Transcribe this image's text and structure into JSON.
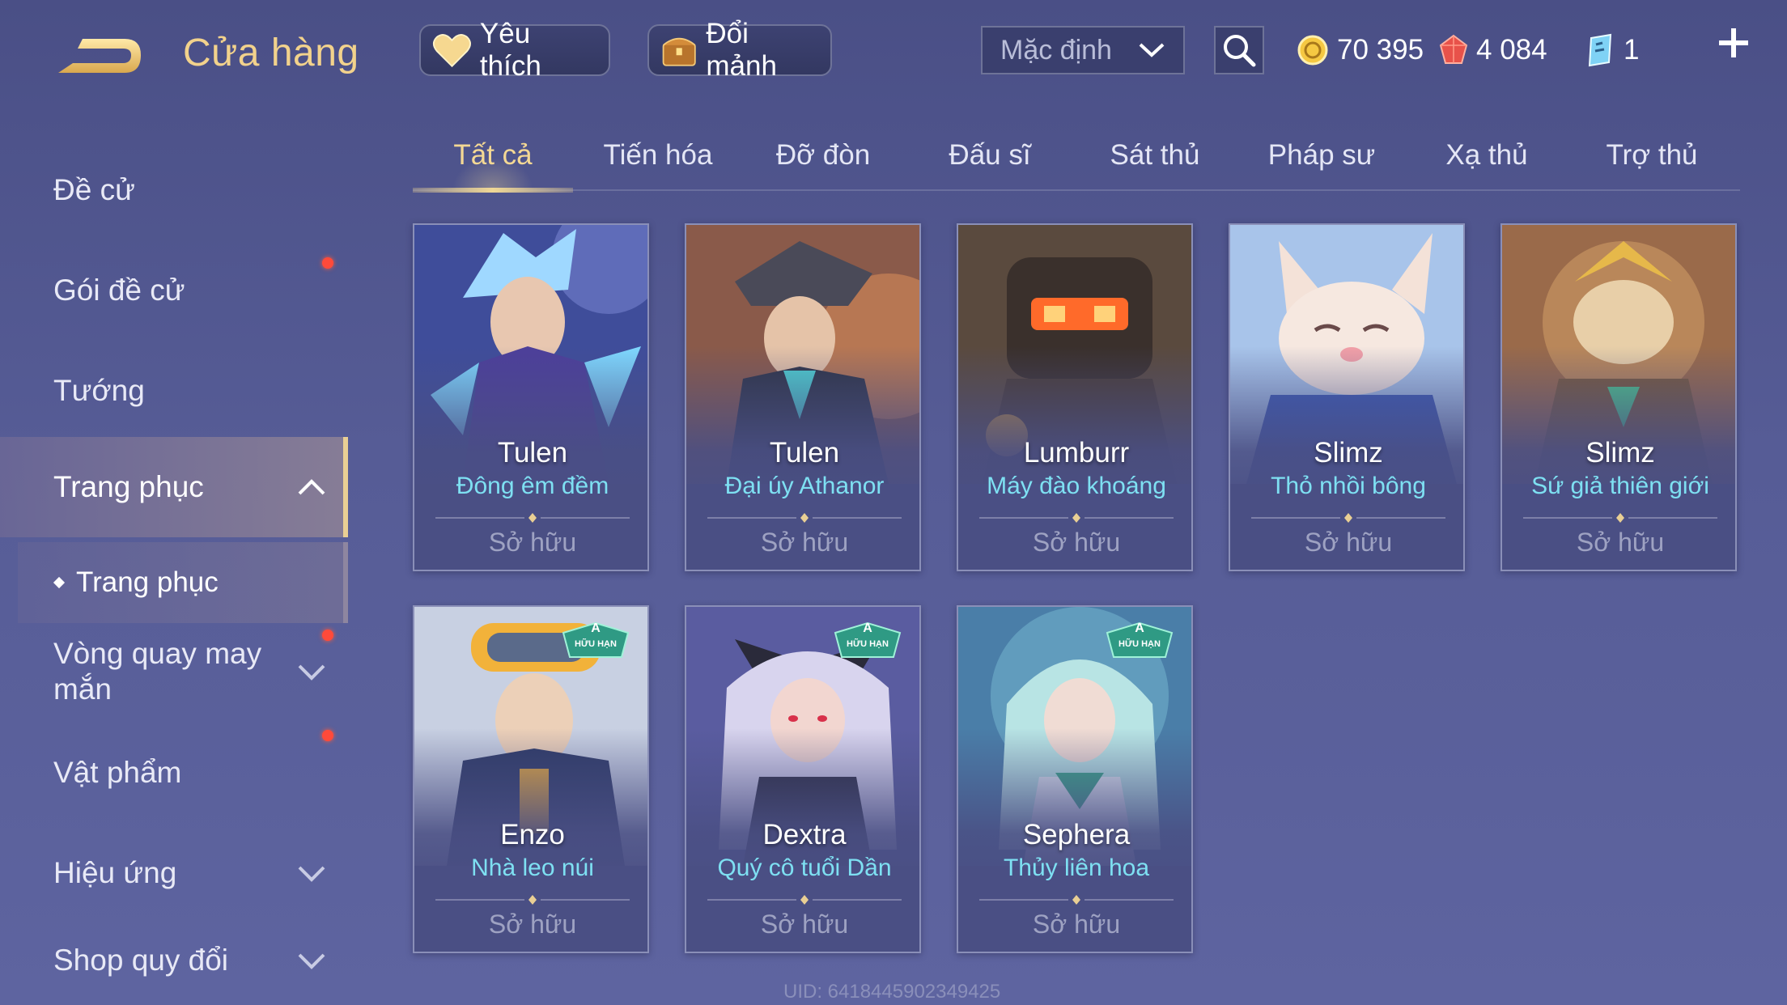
{
  "header": {
    "title": "Cửa hàng",
    "favorite_label": "Yêu thích",
    "fragment_label": "Đổi mảnh",
    "sort_value": "Mặc định"
  },
  "currencies": [
    {
      "icon": "gold-coin-icon",
      "value": "70 395",
      "color": "#f5c842"
    },
    {
      "icon": "ruby-gem-icon",
      "value": "4 084",
      "color": "#e8524a"
    },
    {
      "icon": "ticket-icon",
      "value": "1",
      "color": "#7fd2f5"
    }
  ],
  "sidebar": {
    "items": [
      {
        "label": "Đề cử",
        "has_dot": false,
        "expandable": false
      },
      {
        "label": "Gói đề cử",
        "has_dot": true,
        "expandable": false
      },
      {
        "label": "Tướng",
        "has_dot": false,
        "expandable": false
      },
      {
        "label": "Trang phục",
        "has_dot": false,
        "expandable": true,
        "expanded": true,
        "active": true
      },
      {
        "label": "Vòng quay may mắn",
        "has_dot": true,
        "expandable": true
      },
      {
        "label": "Vật phẩm",
        "has_dot": true,
        "expandable": false
      },
      {
        "label": "Hiệu ứng",
        "has_dot": false,
        "expandable": true
      },
      {
        "label": "Shop quy đổi",
        "has_dot": false,
        "expandable": true
      }
    ],
    "subitem": "Trang phục"
  },
  "tabs": [
    {
      "label": "Tất cả",
      "active": true
    },
    {
      "label": "Tiến hóa"
    },
    {
      "label": "Đỡ đòn"
    },
    {
      "label": "Đấu sĩ"
    },
    {
      "label": "Sát thủ"
    },
    {
      "label": "Pháp sư"
    },
    {
      "label": "Xạ thủ"
    },
    {
      "label": "Trợ thủ"
    }
  ],
  "cards": [
    {
      "hero": "Tulen",
      "skin": "Đông êm đềm",
      "status": "Sở hữu",
      "art": "art-tulen-winter",
      "badge": null
    },
    {
      "hero": "Tulen",
      "skin": "Đại úy Athanor",
      "status": "Sở hữu",
      "art": "art-tulen-captain",
      "badge": null
    },
    {
      "hero": "Lumburr",
      "skin": "Máy đào khoáng",
      "status": "Sở hữu",
      "art": "art-lumburr-miner",
      "badge": null
    },
    {
      "hero": "Slimz",
      "skin": "Thỏ nhồi bông",
      "status": "Sở hữu",
      "art": "art-slimz-plush",
      "badge": null
    },
    {
      "hero": "Slimz",
      "skin": "Sứ giả thiên giới",
      "status": "Sở hữu",
      "art": "art-slimz-envoy",
      "badge": null
    },
    {
      "hero": "Enzo",
      "skin": "Nhà leo núi",
      "status": "Sở hữu",
      "art": "art-enzo-climber",
      "badge": {
        "grade": "A",
        "tag": "HỮU HẠN"
      }
    },
    {
      "hero": "Dextra",
      "skin": "Quý cô tuổi Dần",
      "status": "Sở hữu",
      "art": "art-dextra-tiger",
      "badge": {
        "grade": "A",
        "tag": "HỮU HẠN"
      }
    },
    {
      "hero": "Sephera",
      "skin": "Thủy liên hoa",
      "status": "Sở hữu",
      "art": "art-sephera-lotus",
      "badge": {
        "grade": "A",
        "tag": "HỮU HẠN"
      }
    }
  ],
  "footer": {
    "uid": "UID: 6418445902349425"
  },
  "colors": {
    "accent_gold": "#f0d896",
    "skin_name": "#7ee0f2",
    "notification": "#ff4a3a",
    "background": "#565c96"
  }
}
